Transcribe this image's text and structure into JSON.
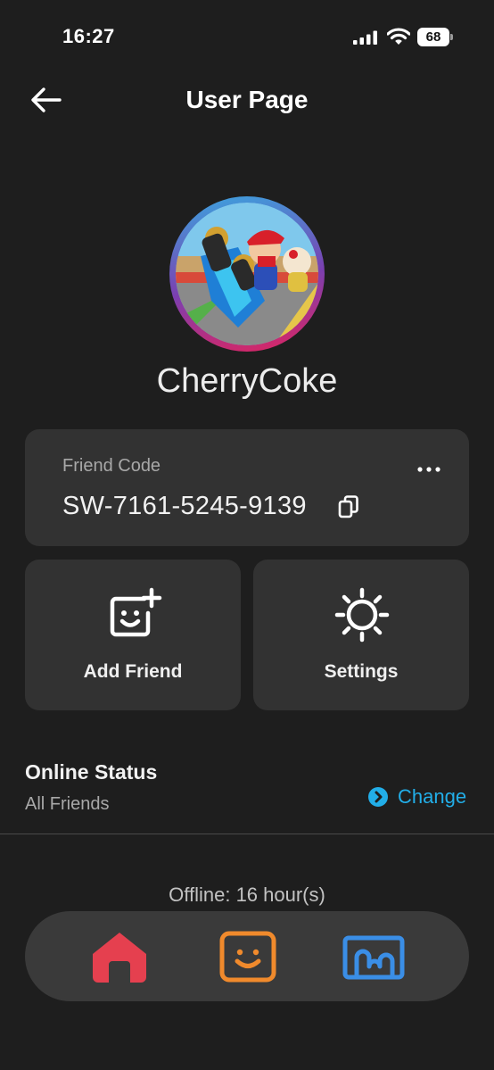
{
  "status_bar": {
    "time": "16:27",
    "battery": "68"
  },
  "header": {
    "title": "User Page",
    "back_icon": "arrow-left-icon"
  },
  "profile": {
    "username": "CherryCoke",
    "avatar": "mario-kart-avatar"
  },
  "friend_code": {
    "label": "Friend Code",
    "value": "SW-7161-5245-9139",
    "copy_icon": "copy-icon",
    "more_icon": "more-dots-icon"
  },
  "actions": [
    {
      "label": "Add Friend",
      "icon": "add-friend-icon"
    },
    {
      "label": "Settings",
      "icon": "gear-icon"
    }
  ],
  "online_status": {
    "title": "Online Status",
    "value": "All Friends",
    "change_label": "Change",
    "change_icon": "chevron-right-circle-icon"
  },
  "last_seen": "Offline: 16 hour(s)",
  "tab_bar": {
    "items": [
      {
        "name": "home",
        "icon": "home-icon",
        "color": "#e5404f"
      },
      {
        "name": "friends",
        "icon": "smiley-icon",
        "color": "#f08a2c"
      },
      {
        "name": "album",
        "icon": "album-icon",
        "color": "#3a8ee6"
      }
    ]
  },
  "colors": {
    "background": "#1e1e1e",
    "card": "#323232",
    "accent": "#22aee8"
  }
}
